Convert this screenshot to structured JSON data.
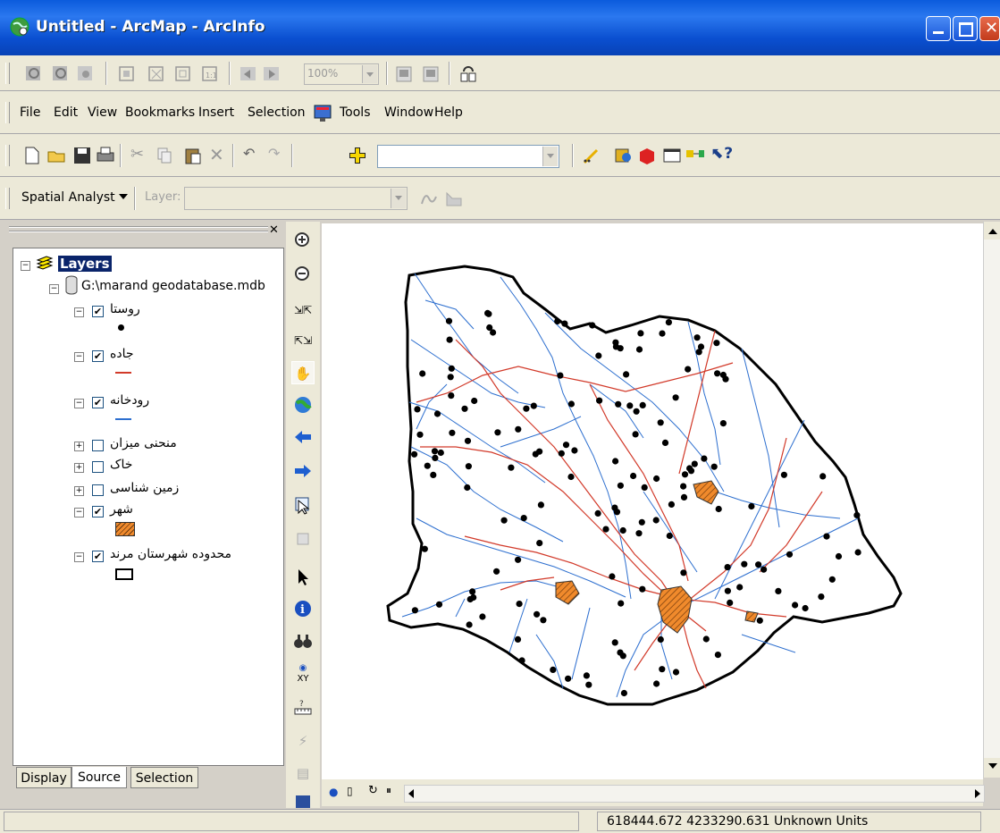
{
  "window": {
    "title": "Untitled - ArcMap - ArcInfo"
  },
  "toolbar_top": {
    "zoom_value": "100%"
  },
  "menu": [
    {
      "label": "File",
      "name": "menu-file"
    },
    {
      "label": "Edit",
      "name": "menu-edit"
    },
    {
      "label": "View",
      "name": "menu-view"
    },
    {
      "label": "Bookmarks",
      "name": "menu-bookmarks"
    },
    {
      "label": "Insert",
      "name": "menu-insert"
    },
    {
      "label": "Selection",
      "name": "menu-selection"
    },
    {
      "label": "Tools",
      "name": "menu-tools"
    },
    {
      "label": "Window",
      "name": "menu-window"
    },
    {
      "label": "Help",
      "name": "menu-help"
    }
  ],
  "spatial": {
    "label": "Spatial Analyst",
    "layer_label": "Layer:"
  },
  "toc": {
    "root": "Layers",
    "db": "G:\\marand geodatabase.mdb",
    "layers": [
      {
        "label": "روستا",
        "checked": true,
        "symbol": "point"
      },
      {
        "label": "جاده",
        "checked": true,
        "symbol": "red-line"
      },
      {
        "label": "رودخانه",
        "checked": true,
        "symbol": "blue-line"
      },
      {
        "label": "منحنی میزان",
        "checked": false,
        "symbol": ""
      },
      {
        "label": "خاک",
        "checked": false,
        "symbol": ""
      },
      {
        "label": "زمین شناسی",
        "checked": false,
        "symbol": ""
      },
      {
        "label": "شهر",
        "checked": true,
        "symbol": "hatched-orange"
      },
      {
        "label": "محدوده شهرستان مرند",
        "checked": true,
        "symbol": "hollow-rect"
      }
    ],
    "tabs": [
      "Display",
      "Source",
      "Selection"
    ]
  },
  "status": {
    "coords": "618444.672  4233290.631 Unknown Units"
  },
  "colors": {
    "titlebar": "#0a4fd0",
    "river": "#2d6fcf",
    "road": "#d23a2a",
    "city": "#f08a2c"
  },
  "icons": [
    "app-globe-icon",
    "zoom-in-icon",
    "zoom-out-icon",
    "fixed-zoom-in-icon",
    "fixed-zoom-out-icon",
    "pan-icon",
    "full-extent-icon",
    "back-icon",
    "forward-icon",
    "select-features-icon",
    "select-elements-icon",
    "identify-icon",
    "find-icon",
    "goto-xy-icon",
    "measure-icon",
    "hyperlink-icon",
    "html-popup-icon"
  ]
}
